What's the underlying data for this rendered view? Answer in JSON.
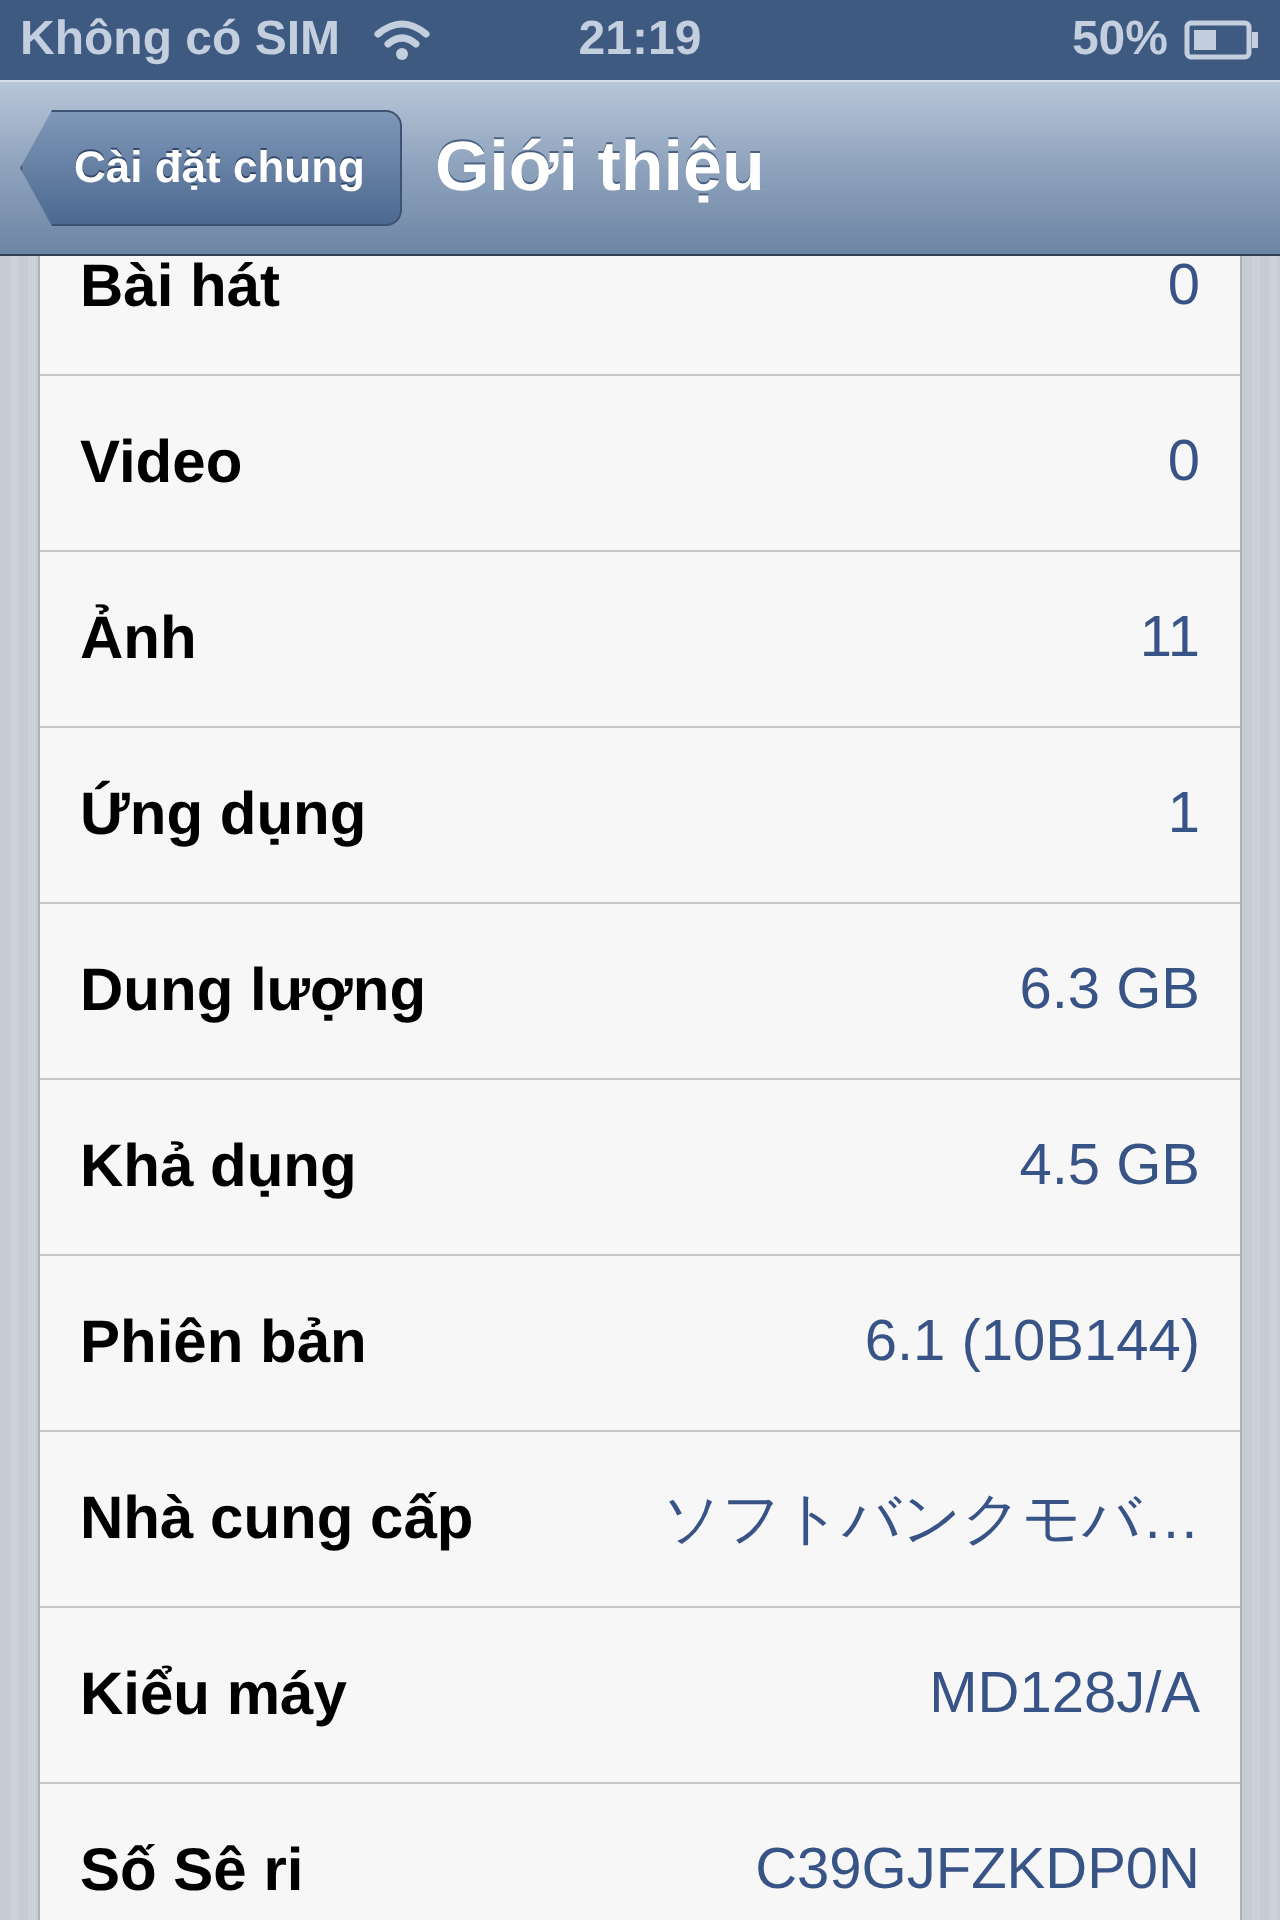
{
  "status_bar": {
    "carrier": "Không có SIM",
    "time": "21:19",
    "battery": "50%"
  },
  "nav_bar": {
    "back": "Cài đặt chung",
    "title": "Giới thiệu"
  },
  "rows": [
    {
      "label": "Bài hát",
      "value": "0"
    },
    {
      "label": "Video",
      "value": "0"
    },
    {
      "label": "Ảnh",
      "value": "11"
    },
    {
      "label": "Ứng dụng",
      "value": "1"
    },
    {
      "label": "Dung lượng",
      "value": "6.3 GB"
    },
    {
      "label": "Khả dụng",
      "value": "4.5 GB"
    },
    {
      "label": "Phiên bản",
      "value": "6.1 (10B144)"
    },
    {
      "label": "Nhà cung cấp",
      "value": "ソフトバンクモバ…"
    },
    {
      "label": "Kiểu máy",
      "value": "MD128J/A"
    },
    {
      "label": "Số Sê ri",
      "value": "C39GJFZKDP0N"
    }
  ]
}
